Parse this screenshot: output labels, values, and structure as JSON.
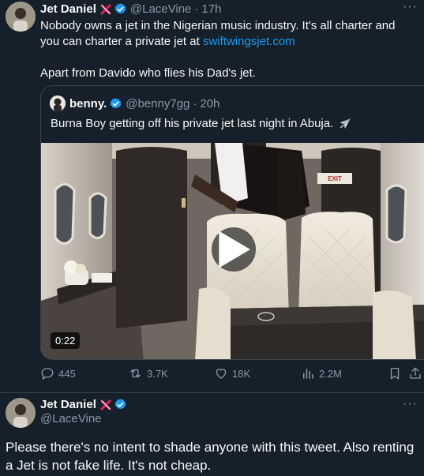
{
  "tweet": {
    "author_name": "Jet Daniel",
    "handle": "@LaceVine",
    "separator": "·",
    "time": "17h",
    "text_line1": "Nobody owns a jet in the Nigerian music industry. It's all charter and you can charter a private jet at ",
    "link": "swiftwingsjet.com",
    "text_para2": "Apart from Davido who flies his Dad's jet.",
    "more": "···"
  },
  "quoted": {
    "author_name": "benny.",
    "handle": "@benny7gg",
    "separator": "·",
    "time": "20h",
    "text": "Burna Boy getting off his private jet last night in Abuja.",
    "video_duration": "0:22",
    "exit_sign": "EXIT"
  },
  "actions": {
    "replies": "445",
    "reposts": "3.7K",
    "likes": "18K",
    "views": "2.2M"
  },
  "reply": {
    "author_name": "Jet Daniel",
    "handle": "@LaceVine",
    "text": "Please there's no intent to shade anyone with this tweet. Also renting a Jet is not fake life.  It's not cheap.",
    "more": "···"
  },
  "colors": {
    "background": "#15202b",
    "link": "#1d9bf0",
    "verified": "#1d9bf0",
    "muted": "#8b98a5",
    "border": "#38444d"
  },
  "icons": [
    "x-cross-emoji-icon",
    "verified-badge-icon",
    "airplane-emoji-icon",
    "play-icon",
    "reply-icon",
    "repost-icon",
    "like-icon",
    "views-icon",
    "bookmark-icon",
    "share-icon",
    "more-icon"
  ]
}
